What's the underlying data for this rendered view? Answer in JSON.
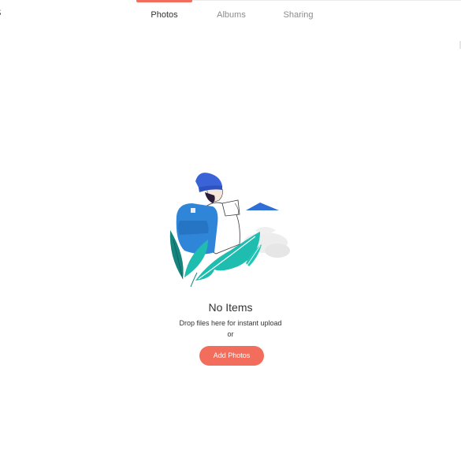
{
  "app": {
    "title": "tos"
  },
  "tabs": [
    {
      "label": "Photos",
      "active": true
    },
    {
      "label": "Albums",
      "active": false
    },
    {
      "label": "Sharing",
      "active": false
    }
  ],
  "empty_state": {
    "illustration_icon": "hiker-with-backpack-illustration",
    "title": "No Items",
    "subtitle": "Drop files here for instant upload",
    "or_label": "or",
    "add_button_label": "Add Photos"
  },
  "colors": {
    "accent": "#f26d5b",
    "illustration_blue": "#2f86d9",
    "illustration_teal": "#1fbcb0",
    "hat_blue": "#3b63d8"
  }
}
